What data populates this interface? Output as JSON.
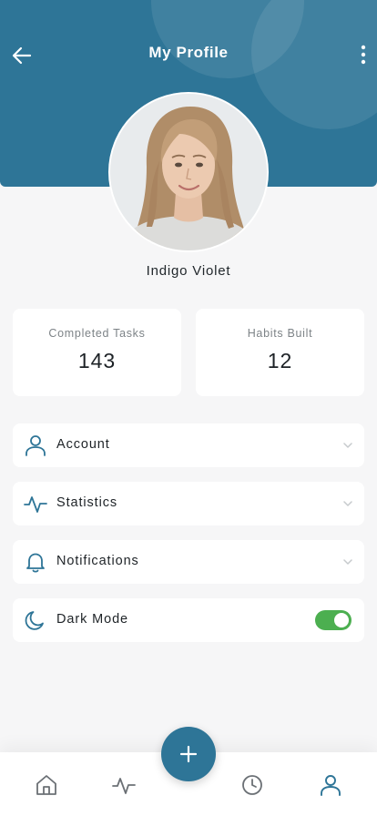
{
  "header": {
    "title": "My Profile",
    "back_icon": "arrow-left-icon",
    "more_icon": "more-vertical-icon"
  },
  "profile": {
    "name": "Indigo Violet"
  },
  "stats": [
    {
      "label": "Completed Tasks",
      "value": "143"
    },
    {
      "label": "Habits Built",
      "value": "12"
    }
  ],
  "menu": [
    {
      "label": "Account",
      "icon": "user-icon"
    },
    {
      "label": "Statistics",
      "icon": "activity-icon"
    },
    {
      "label": "Notifications",
      "icon": "bell-icon"
    }
  ],
  "dark_mode": {
    "label": "Dark Mode",
    "icon": "moon-icon",
    "enabled": true
  },
  "bottom_nav": {
    "items": [
      "home-icon",
      "activity-icon",
      "clock-icon",
      "user-icon"
    ],
    "fab_icon": "plus-icon"
  },
  "colors": {
    "primary": "#2e7597",
    "toggle_on": "#4caf50",
    "background": "#f6f6f7"
  }
}
